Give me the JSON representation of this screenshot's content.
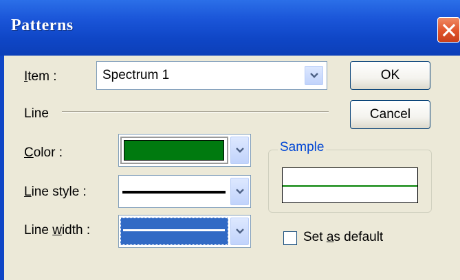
{
  "window": {
    "title": "Patterns"
  },
  "item": {
    "label": "Item :",
    "accesskey": "I",
    "rest": "tem :",
    "value": "Spectrum 1"
  },
  "line_section": {
    "label": "Line"
  },
  "color": {
    "label_acc": "C",
    "label_rest": "olor :",
    "swatch": "#007a0f"
  },
  "line_style": {
    "label_acc": "L",
    "label_rest": "ine style :"
  },
  "line_width": {
    "label_pre": "Line ",
    "label_acc": "w",
    "label_rest": "idth :",
    "swatch": "#316ac5"
  },
  "buttons": {
    "ok": "OK",
    "cancel": "Cancel"
  },
  "sample": {
    "label": "Sample",
    "line_color": "#008000"
  },
  "set_default": {
    "label_pre": "Set ",
    "label_acc": "a",
    "label_rest": "s default",
    "checked": false
  },
  "icons": {
    "close": "close-icon",
    "dropdown": "chevron-down-icon"
  }
}
